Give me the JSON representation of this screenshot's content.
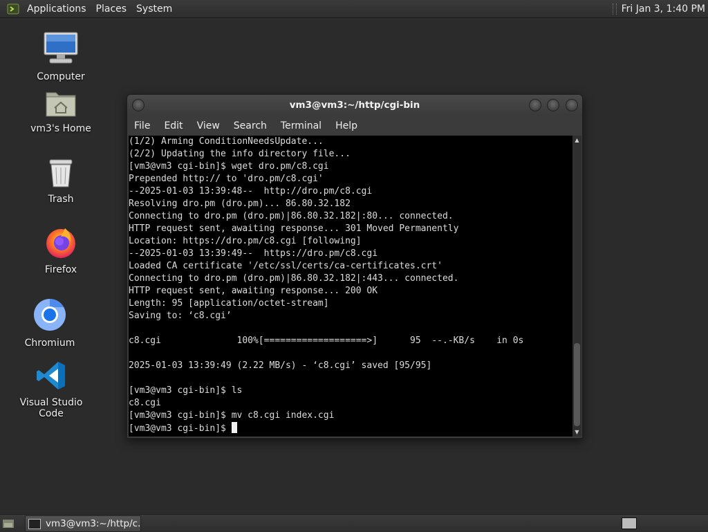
{
  "top_panel": {
    "menus": [
      "Applications",
      "Places",
      "System"
    ],
    "clock": "Fri Jan  3,  1:40 PM"
  },
  "desktop_icons": [
    {
      "label": "Computer",
      "icon": "computer-icon"
    },
    {
      "label": "vm3's Home",
      "icon": "home-folder-icon"
    },
    {
      "label": "Trash",
      "icon": "trash-icon"
    },
    {
      "label": "Firefox",
      "icon": "firefox-icon"
    },
    {
      "label": "Chromium",
      "icon": "chromium-icon"
    },
    {
      "label": "Visual Studio Code",
      "icon": "vscode-icon"
    }
  ],
  "terminal": {
    "title": "vm3@vm3:~/http/cgi-bin",
    "menu": [
      "File",
      "Edit",
      "View",
      "Search",
      "Terminal",
      "Help"
    ],
    "lines": [
      "(1/2) Arming ConditionNeedsUpdate...",
      "(2/2) Updating the info directory file...",
      "[vm3@vm3 cgi-bin]$ wget dro.pm/c8.cgi",
      "Prepended http:// to 'dro.pm/c8.cgi'",
      "--2025-01-03 13:39:48--  http://dro.pm/c8.cgi",
      "Resolving dro.pm (dro.pm)... 86.80.32.182",
      "Connecting to dro.pm (dro.pm)|86.80.32.182|:80... connected.",
      "HTTP request sent, awaiting response... 301 Moved Permanently",
      "Location: https://dro.pm/c8.cgi [following]",
      "--2025-01-03 13:39:49--  https://dro.pm/c8.cgi",
      "Loaded CA certificate '/etc/ssl/certs/ca-certificates.crt'",
      "Connecting to dro.pm (dro.pm)|86.80.32.182|:443... connected.",
      "HTTP request sent, awaiting response... 200 OK",
      "Length: 95 [application/octet-stream]",
      "Saving to: ‘c8.cgi’",
      "",
      "c8.cgi              100%[===================>]      95  --.-KB/s    in 0s",
      "",
      "2025-01-03 13:39:49 (2.22 MB/s) - ‘c8.cgi’ saved [95/95]",
      "",
      "[vm3@vm3 cgi-bin]$ ls",
      "c8.cgi",
      "[vm3@vm3 cgi-bin]$ mv c8.cgi index.cgi"
    ],
    "prompt": "[vm3@vm3 cgi-bin]$ "
  },
  "taskbar": {
    "window_label": "vm3@vm3:~/http/c..."
  }
}
